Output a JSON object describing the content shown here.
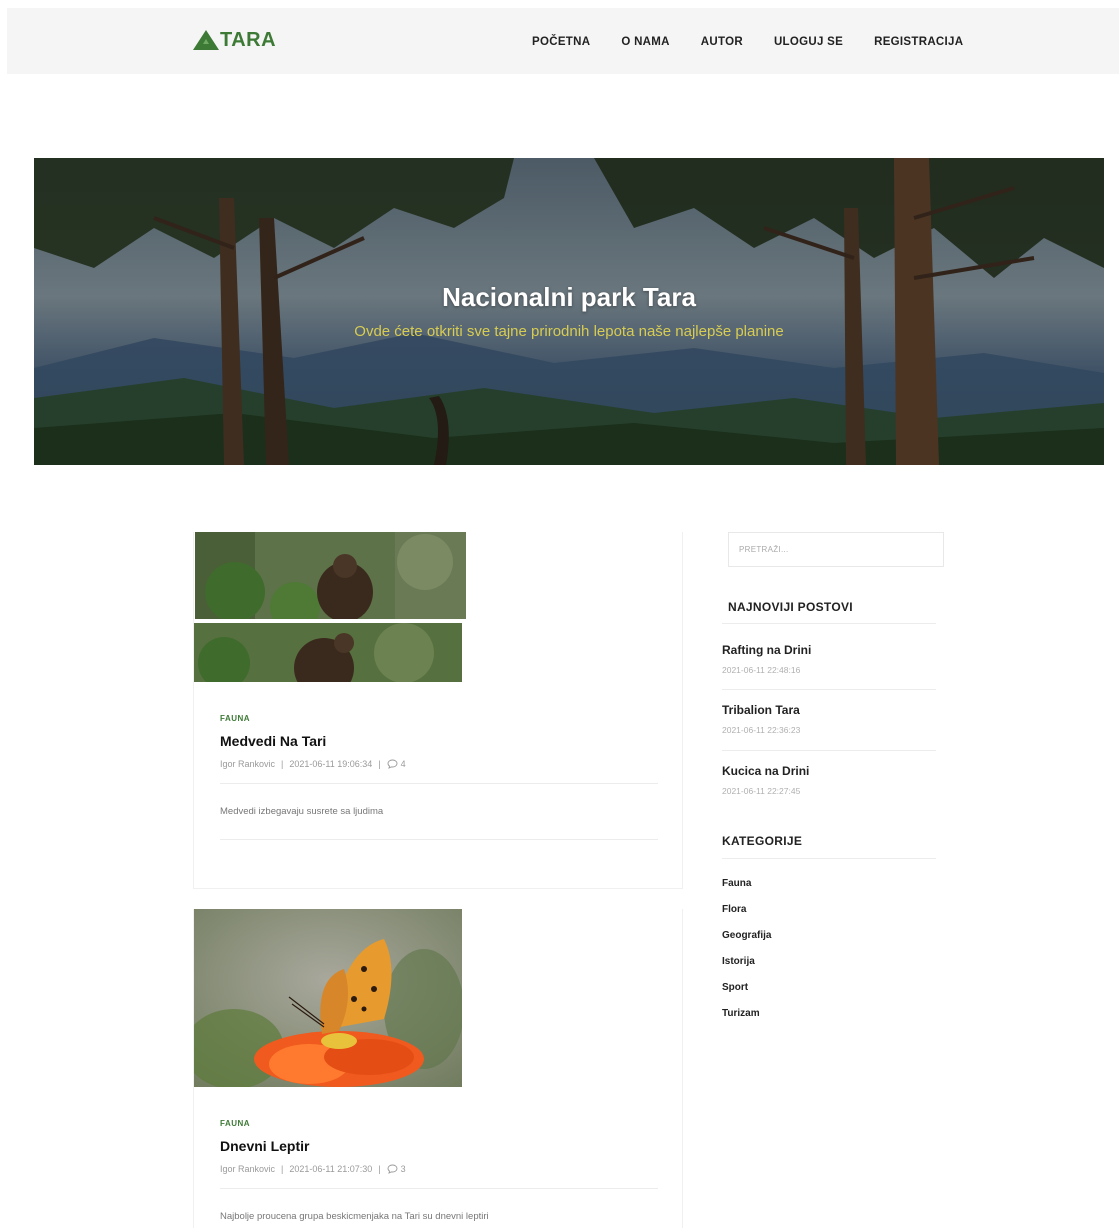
{
  "header": {
    "logo_text": "TARA",
    "nav": [
      "POČETNA",
      "O NAMA",
      "AUTOR",
      "ULOGUJ SE",
      "REGISTRACIJA"
    ]
  },
  "hero": {
    "title": "Nacionalni park Tara",
    "subtitle": "Ovde ćete otkriti sve tajne prirodnih lepota naše najlepše planine"
  },
  "posts": [
    {
      "category": "FAUNA",
      "title": "Medvedi Na Tari",
      "author": "Igor Rankovic",
      "sep1": "|",
      "date": "2021-06-11 19:06:34",
      "sep2": "|",
      "comments": "4",
      "excerpt": "Medvedi izbegavaju susrete sa ljudima"
    },
    {
      "category": "FAUNA",
      "title": "Dnevni Leptir",
      "author": "Igor Rankovic",
      "sep1": "|",
      "date": "2021-06-11 21:07:30",
      "sep2": "|",
      "comments": "3",
      "excerpt": "Najbolje proucena grupa beskicmenjaka na Tari su dnevni leptiri"
    }
  ],
  "sidebar": {
    "search_placeholder": "PRETRAŽI...",
    "recent_heading": "NAJNOVIJI POSTOVI",
    "recent_posts": [
      {
        "title": "Rafting na Drini",
        "date": "2021-06-11 22:48:16"
      },
      {
        "title": "Tribalion Tara",
        "date": "2021-06-11 22:36:23"
      },
      {
        "title": "Kucica na Drini",
        "date": "2021-06-11 22:27:45"
      }
    ],
    "categories_heading": "KATEGORIJE",
    "categories": [
      "Fauna",
      "Flora",
      "Geografija",
      "Istorija",
      "Sport",
      "Turizam"
    ]
  },
  "colors": {
    "brand_green": "#3d7a36",
    "hero_subtitle": "#d8cc52",
    "navbar_bg": "#f5f5f5"
  },
  "icons": {
    "logo": "mountain-icon",
    "comments": "comment-bubble-icon"
  }
}
